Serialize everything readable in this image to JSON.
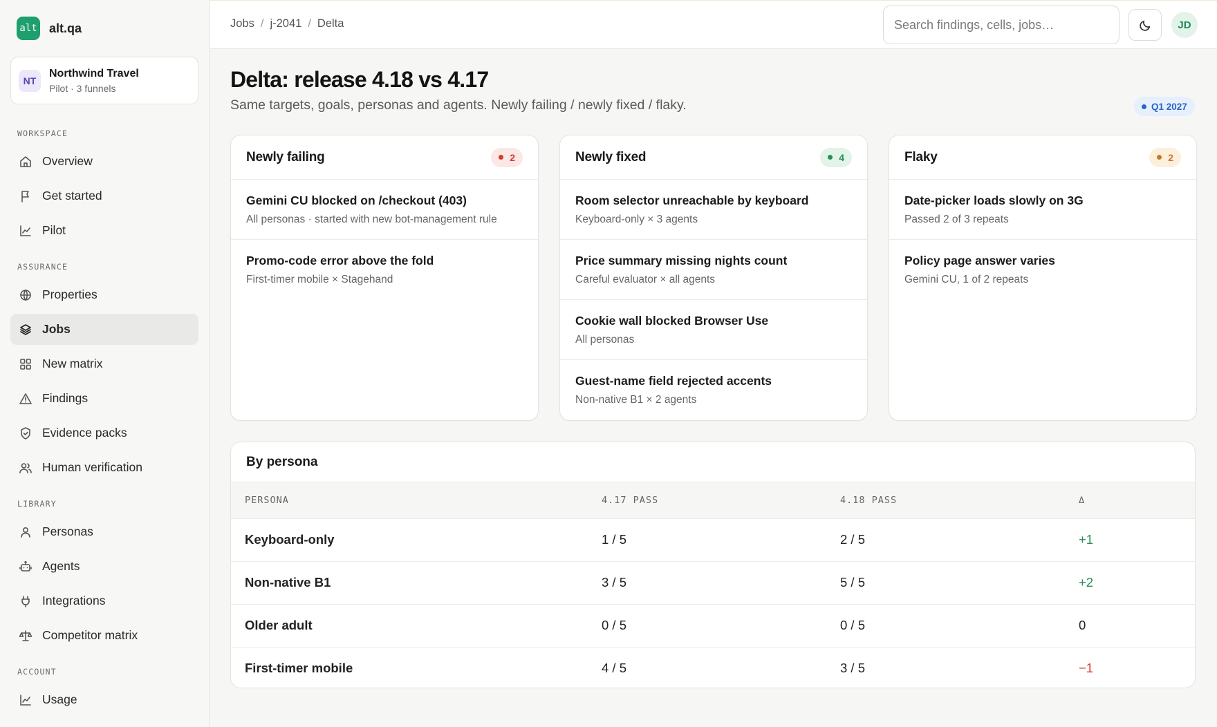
{
  "brand": {
    "logo": "alt",
    "name": "alt.qa"
  },
  "org": {
    "initials": "NT",
    "name": "Northwind Travel",
    "sub": "Pilot · 3 funnels"
  },
  "sidebar": {
    "sections": {
      "workspace": "WORKSPACE",
      "assurance": "ASSURANCE",
      "library": "LIBRARY",
      "account": "ACCOUNT"
    },
    "items": [
      {
        "label": "Overview",
        "icon": "home-icon"
      },
      {
        "label": "Get started",
        "icon": "flag-icon"
      },
      {
        "label": "Pilot",
        "icon": "chart-line-icon"
      },
      {
        "label": "Properties",
        "icon": "globe-icon"
      },
      {
        "label": "Jobs",
        "icon": "layers-icon",
        "active": true
      },
      {
        "label": "New matrix",
        "icon": "grid-icon"
      },
      {
        "label": "Findings",
        "icon": "warning-icon"
      },
      {
        "label": "Evidence packs",
        "icon": "shield-check-icon"
      },
      {
        "label": "Human verification",
        "icon": "users-icon"
      },
      {
        "label": "Personas",
        "icon": "user-icon"
      },
      {
        "label": "Agents",
        "icon": "robot-icon"
      },
      {
        "label": "Integrations",
        "icon": "plug-icon"
      },
      {
        "label": "Competitor matrix",
        "icon": "scale-icon"
      },
      {
        "label": "Usage",
        "icon": "chart-line-icon"
      }
    ]
  },
  "header": {
    "breadcrumb": [
      "Jobs",
      "j-2041",
      "Delta"
    ],
    "search_placeholder": "Search findings, cells, jobs…",
    "theme_icon": "moon-icon",
    "user_initials": "JD"
  },
  "page": {
    "title": "Delta: release 4.18 vs 4.17",
    "subtitle": "Same targets, goals, personas and agents. Newly failing / newly fixed / flaky.",
    "period": "Q1 2027"
  },
  "cards": {
    "failing": {
      "title": "Newly failing",
      "count": "2",
      "color": "#d23b2e",
      "items": [
        {
          "title": "Gemini CU blocked on /checkout (403)",
          "sub": "All personas · started with new bot-management rule"
        },
        {
          "title": "Promo-code error above the fold",
          "sub": "First-timer mobile × Stagehand"
        }
      ]
    },
    "fixed": {
      "title": "Newly fixed",
      "count": "4",
      "color": "#2a8c57",
      "items": [
        {
          "title": "Room selector unreachable by keyboard",
          "sub": "Keyboard-only × 3 agents"
        },
        {
          "title": "Price summary missing nights count",
          "sub": "Careful evaluator × all agents"
        },
        {
          "title": "Cookie wall blocked Browser Use",
          "sub": "All personas"
        },
        {
          "title": "Guest-name field rejected accents",
          "sub": "Non-native B1 × 2 agents"
        }
      ]
    },
    "flaky": {
      "title": "Flaky",
      "count": "2",
      "color": "#c4782a",
      "items": [
        {
          "title": "Date-picker loads slowly on 3G",
          "sub": "Passed 2 of 3 repeats"
        },
        {
          "title": "Policy page answer varies",
          "sub": "Gemini CU, 1 of 2 repeats"
        }
      ]
    }
  },
  "persona_table": {
    "title": "By persona",
    "columns": [
      "PERSONA",
      "4.17 PASS",
      "4.18 PASS",
      "Δ"
    ],
    "rows": [
      {
        "persona": "Keyboard-only",
        "prev": "1 / 5",
        "curr": "2 / 5",
        "delta": "+1"
      },
      {
        "persona": "Non-native B1",
        "prev": "3 / 5",
        "curr": "5 / 5",
        "delta": "+2"
      },
      {
        "persona": "Older adult",
        "prev": "0 / 5",
        "curr": "0 / 5",
        "delta": "0"
      },
      {
        "persona": "First-timer mobile",
        "prev": "4 / 5",
        "curr": "3 / 5",
        "delta": "−1"
      }
    ]
  }
}
